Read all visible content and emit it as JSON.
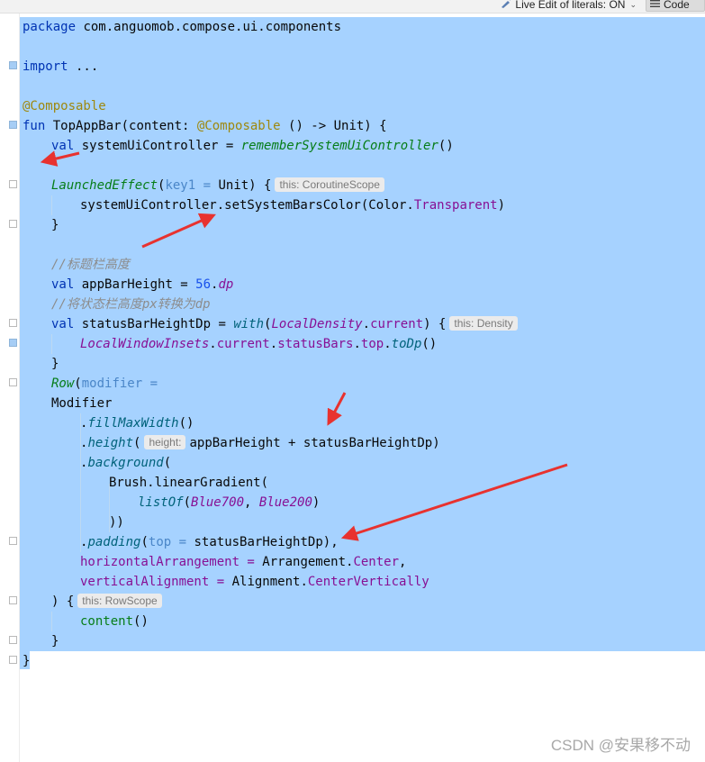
{
  "toolbar": {
    "live_edit_label": "Live Edit of literals: ON",
    "code_label": "Code"
  },
  "hints": {
    "coroutine_scope": "this: CoroutineScope",
    "density": "this: Density",
    "height_param": "height:",
    "row_scope": "this: RowScope"
  },
  "code": {
    "l1_kw": "package",
    "l1_rest": " com.anguomob.compose.ui.components",
    "l3_kw": "import",
    "l3_rest": " ...",
    "l5_ann": "@Composable",
    "l6_kw": "fun",
    "l6_a": " TopAppBar(content: ",
    "l6_ann": "@Composable",
    "l6_b": " () -> Unit) {",
    "l7_kw": "val",
    "l7_a": " systemUiController = ",
    "l7_ext": "rememberSystemUiController",
    "l7_b": "()",
    "l9_comp": "LaunchedEffect",
    "l9_a": "(",
    "l9_param": "key1 =",
    "l9_b": " Unit) {",
    "l10_a": "systemUiController.setSystemBarsColor(Color.",
    "l10_prop": "Transparent",
    "l10_b": ")",
    "l11": "}",
    "l13_cmt": "//标题栏高度",
    "l14_kw": "val",
    "l14_a": " appBarHeight = ",
    "l14_num": "56",
    "l14_b": ".",
    "l14_prop": "dp",
    "l15_cmt": "//将状态栏高度px转换为dp",
    "l16_kw": "val",
    "l16_a": " statusBarHeightDp = ",
    "l16_ext": "with",
    "l16_b": "(",
    "l16_ital": "LocalDensity",
    "l16_c": ".",
    "l16_prop": "current",
    "l16_d": ") {",
    "l17_ital": "LocalWindowInsets",
    "l17_a": ".",
    "l17_prop1": "current",
    "l17_b": ".",
    "l17_prop2": "statusBars",
    "l17_c": ".",
    "l17_prop3": "top",
    "l17_d": ".",
    "l17_ext": "toDp",
    "l17_e": "()",
    "l18": "}",
    "l19_comp": "Row",
    "l19_a": "(",
    "l19_param": "modifier =",
    "l20": "Modifier",
    "l21_a": ".",
    "l21_ext": "fillMaxWidth",
    "l21_b": "()",
    "l22_a": ".",
    "l22_ext": "height",
    "l22_b": "(",
    "l22_c": "appBarHeight + statusBarHeightDp)",
    "l23_a": ".",
    "l23_ext": "background",
    "l23_b": "(",
    "l24": "Brush.linearGradient(",
    "l25_ext": "listOf",
    "l25_a": "(",
    "l25_ital1": "Blue700",
    "l25_b": ", ",
    "l25_ital2": "Blue200",
    "l25_c": ")",
    "l26": "))",
    "l27_a": ".",
    "l27_ext": "padding",
    "l27_b": "(",
    "l27_param": "top =",
    "l27_c": " statusBarHeightDp),",
    "l28_param": "horizontalArrangement =",
    "l28_a": " Arrangement.",
    "l28_prop": "Center",
    "l28_b": ",",
    "l29_param": "verticalAlignment =",
    "l29_a": " Alignment.",
    "l29_prop": "CenterVertically",
    "l30": ") {",
    "l31_comp": "content",
    "l31_a": "()",
    "l32": "}",
    "l33": "}"
  },
  "watermark": "CSDN @安果移不动",
  "colors": {
    "selection": "#a6d2ff",
    "keyword": "#0033b3",
    "annotation": "#9e880d",
    "comment": "#8c8c8c",
    "arrow": "#e8322f"
  },
  "icons": {
    "live_edit": "pencil-wand-icon",
    "code_view": "lines-icon",
    "intention": "lightbulb-icon"
  }
}
